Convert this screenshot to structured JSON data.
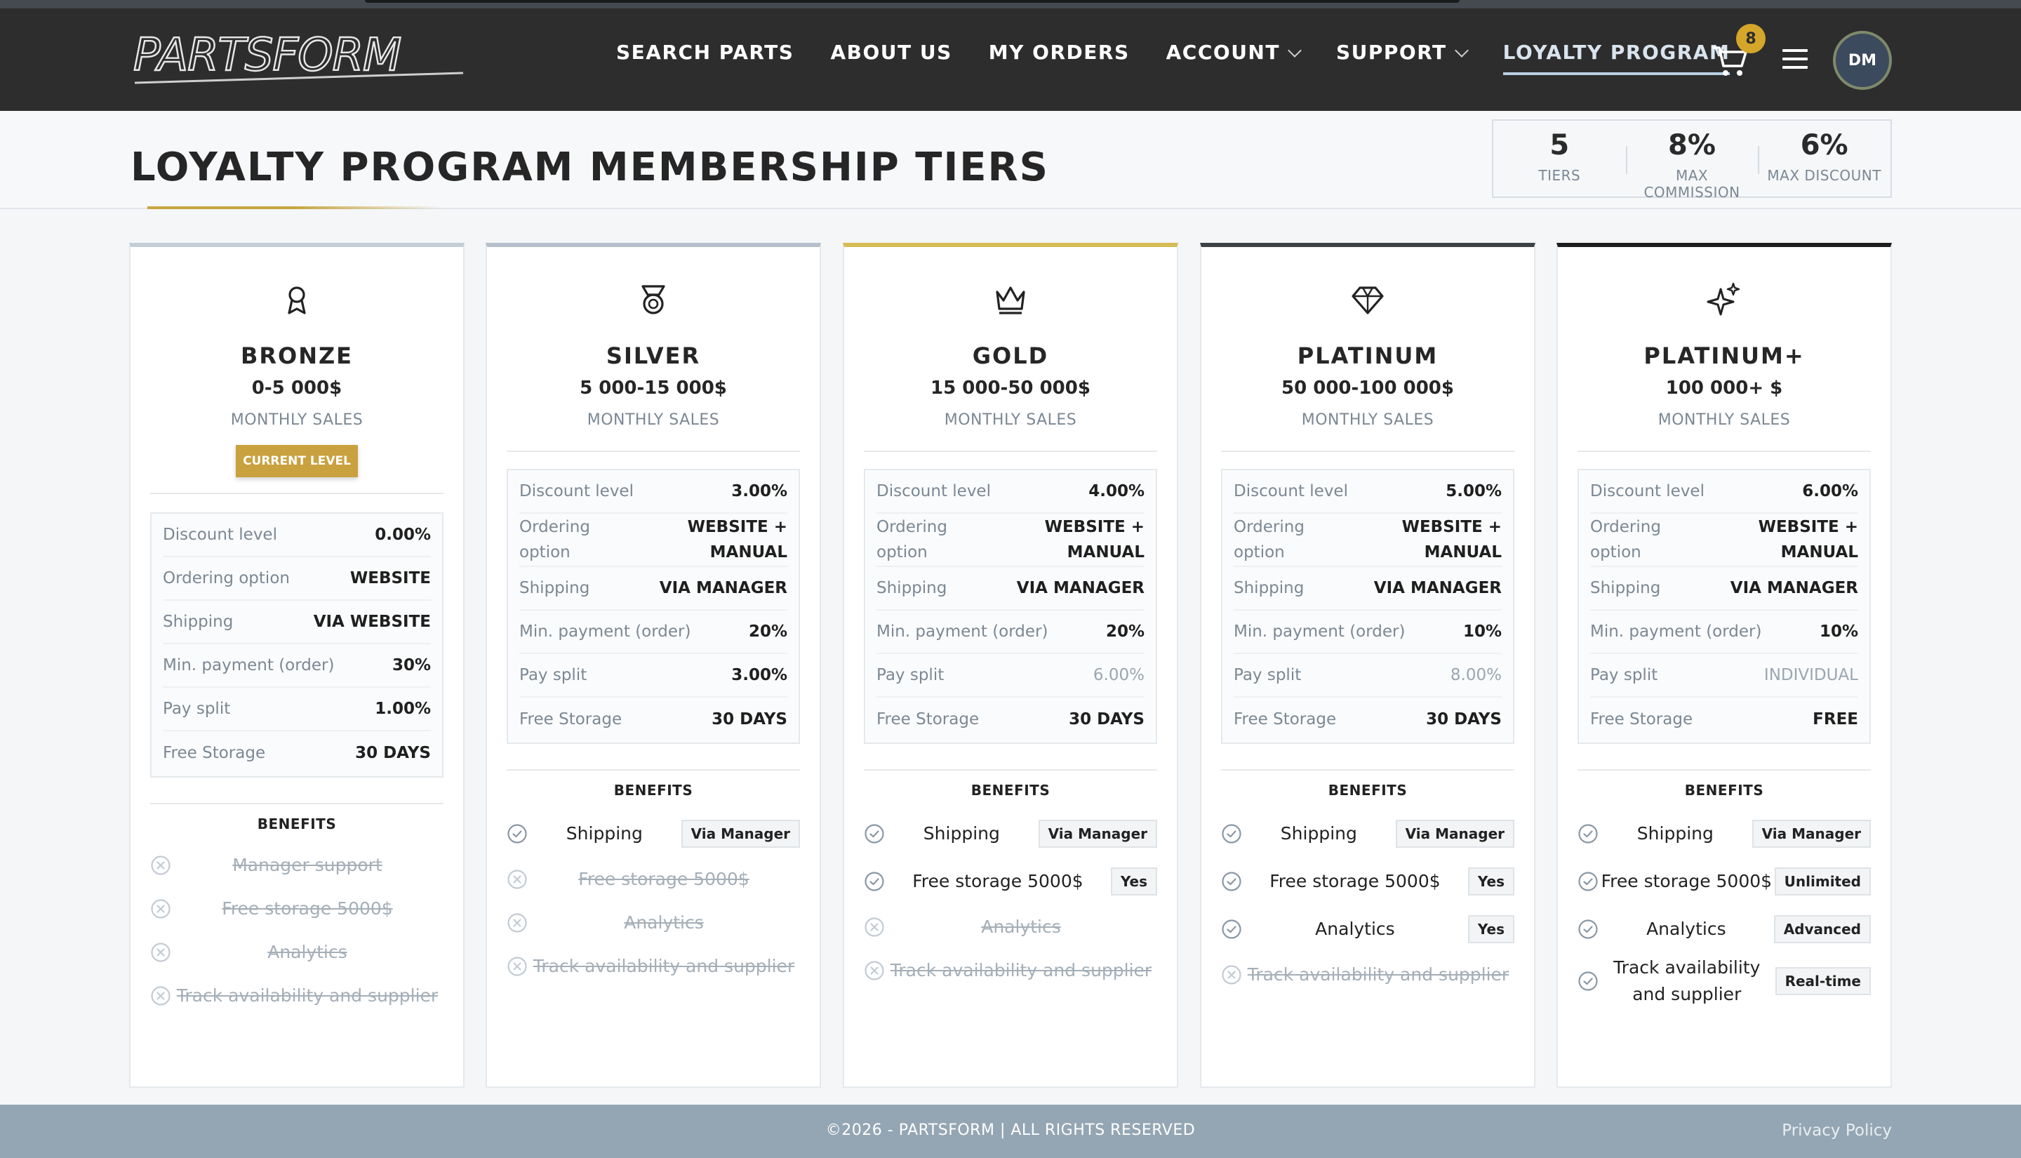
{
  "header": {
    "logo_text": "PARTSFORM",
    "nav": [
      {
        "label": "SEARCH PARTS",
        "has_dropdown": false,
        "active": false
      },
      {
        "label": "ABOUT US",
        "has_dropdown": false,
        "active": false
      },
      {
        "label": "MY ORDERS",
        "has_dropdown": false,
        "active": false
      },
      {
        "label": "ACCOUNT",
        "has_dropdown": true,
        "active": false
      },
      {
        "label": "SUPPORT",
        "has_dropdown": true,
        "active": false
      },
      {
        "label": "LOYALTY PROGRAM",
        "has_dropdown": false,
        "active": true
      }
    ],
    "cart_count": "8",
    "cart_icon": "shopping-cart-icon",
    "menu_icon": "hamburger-menu-icon",
    "avatar_initials": "DM"
  },
  "page": {
    "title": "LOYALTY PROGRAM MEMBERSHIP TIERS"
  },
  "stats": [
    {
      "value": "5",
      "label": "TIERS"
    },
    {
      "value": "8%",
      "label": "MAX COMMISSION"
    },
    {
      "value": "6%",
      "label": "MAX DISCOUNT"
    }
  ],
  "labels": {
    "monthly_sales": "MONTHLY SALES",
    "current_level": "CURRENT LEVEL",
    "benefits": "BENEFITS",
    "discount_level": "Discount level",
    "ordering_option": "Ordering option",
    "shipping": "Shipping",
    "min_payment": "Min. payment (order)",
    "pay_split": "Pay split",
    "free_storage": "Free Storage"
  },
  "tiers": [
    {
      "name": "BRONZE",
      "range": "0-5 000$",
      "icon": "award-ribbon-icon",
      "accent": "#c3cdd6",
      "current": true,
      "discount": "0.00%",
      "ordering": "WEBSITE",
      "shipping": "VIA WEBSITE",
      "min_payment": "30%",
      "pay_split": "1.00%",
      "pay_split_muted": false,
      "storage": "30 DAYS",
      "benefits": [
        {
          "text": "Manager support",
          "enabled": false,
          "tag": ""
        },
        {
          "text": "Free storage 5000$",
          "enabled": false,
          "tag": ""
        },
        {
          "text": "Analytics",
          "enabled": false,
          "tag": ""
        },
        {
          "text": "Track availability and supplier",
          "enabled": false,
          "tag": ""
        }
      ]
    },
    {
      "name": "SILVER",
      "range": "5 000-15 000$",
      "icon": "medal-icon",
      "accent": "#b5c0ca",
      "current": false,
      "discount": "3.00%",
      "ordering": "WEBSITE + MANUAL",
      "shipping": "VIA MANAGER",
      "min_payment": "20%",
      "pay_split": "3.00%",
      "pay_split_muted": false,
      "storage": "30 DAYS",
      "benefits": [
        {
          "text": "Shipping",
          "enabled": true,
          "tag": "Via Manager"
        },
        {
          "text": "Free storage 5000$",
          "enabled": false,
          "tag": ""
        },
        {
          "text": "Analytics",
          "enabled": false,
          "tag": ""
        },
        {
          "text": "Track availability and supplier",
          "enabled": false,
          "tag": ""
        }
      ]
    },
    {
      "name": "GOLD",
      "range": "15 000-50 000$",
      "icon": "crown-icon",
      "accent": "#d5bd55",
      "current": false,
      "discount": "4.00%",
      "ordering": "WEBSITE + MANUAL",
      "shipping": "VIA MANAGER",
      "min_payment": "20%",
      "pay_split": "6.00%",
      "pay_split_muted": true,
      "storage": "30 DAYS",
      "benefits": [
        {
          "text": "Shipping",
          "enabled": true,
          "tag": "Via Manager"
        },
        {
          "text": "Free storage 5000$",
          "enabled": true,
          "tag": "Yes"
        },
        {
          "text": "Analytics",
          "enabled": false,
          "tag": ""
        },
        {
          "text": "Track availability and supplier",
          "enabled": false,
          "tag": ""
        }
      ]
    },
    {
      "name": "PLATINUM",
      "range": "50 000-100 000$",
      "icon": "diamond-icon",
      "accent": "#3c4246",
      "current": false,
      "discount": "5.00%",
      "ordering": "WEBSITE + MANUAL",
      "shipping": "VIA MANAGER",
      "min_payment": "10%",
      "pay_split": "8.00%",
      "pay_split_muted": true,
      "storage": "30 DAYS",
      "benefits": [
        {
          "text": "Shipping",
          "enabled": true,
          "tag": "Via Manager"
        },
        {
          "text": "Free storage 5000$",
          "enabled": true,
          "tag": "Yes"
        },
        {
          "text": "Analytics",
          "enabled": true,
          "tag": "Yes"
        },
        {
          "text": "Track availability and supplier",
          "enabled": false,
          "tag": ""
        }
      ]
    },
    {
      "name": "PLATINUM+",
      "range": "100 000+ $",
      "icon": "sparkles-icon",
      "accent": "#1f1f1f",
      "current": false,
      "discount": "6.00%",
      "ordering": "WEBSITE + MANUAL",
      "shipping": "VIA MANAGER",
      "min_payment": "10%",
      "pay_split": "INDIVIDUAL",
      "pay_split_muted": true,
      "storage": "FREE",
      "benefits": [
        {
          "text": "Shipping",
          "enabled": true,
          "tag": "Via Manager"
        },
        {
          "text": "Free storage 5000$",
          "enabled": true,
          "tag": "Unlimited"
        },
        {
          "text": "Analytics",
          "enabled": true,
          "tag": "Advanced"
        },
        {
          "text": "Track availability and supplier",
          "enabled": true,
          "tag": "Real-time"
        }
      ]
    }
  ],
  "footer": {
    "copyright": "©2026 - PARTSFORM | ALL RIGHTS RESERVED",
    "privacy": "Privacy Policy"
  }
}
